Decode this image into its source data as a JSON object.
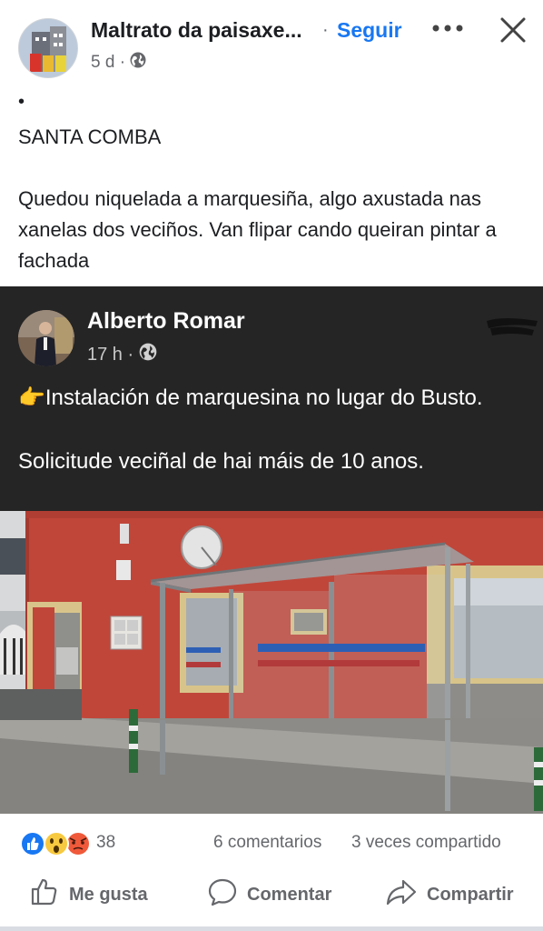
{
  "header": {
    "page_name": "Maltrato da paisaxe...",
    "separator": "·",
    "follow_label": "Seguir",
    "more_icon": "more-horizontal-icon",
    "close_icon": "close-icon",
    "time": "5 d ·",
    "privacy_icon": "globe-icon"
  },
  "post": {
    "bullet": "•",
    "title": "SANTA COMBA",
    "body": "Quedou niquelada a marquesiña, algo axustada nas xanelas dos veciños. Van flipar cando queiran pintar a fachada"
  },
  "shared": {
    "author": "Alberto Romar",
    "time": "17 h ·",
    "privacy_icon": "globe-icon",
    "line1": "👉Instalación de marquesina no lugar do Busto.",
    "line2": "Solicitude veciñal de hai máis de 10 anos."
  },
  "stats": {
    "reaction_count": "38",
    "comments": "6 comentarios",
    "shares": "3 veces compartido",
    "reaction_icons": [
      "like-icon",
      "wow-icon",
      "angry-icon"
    ]
  },
  "actions": {
    "like": "Me gusta",
    "comment": "Comentar",
    "share": "Compartir"
  },
  "colors": {
    "accent": "#1877f2",
    "shared_bg": "#252525",
    "wall_red": "#c0463a",
    "muted_text": "#65676b"
  }
}
